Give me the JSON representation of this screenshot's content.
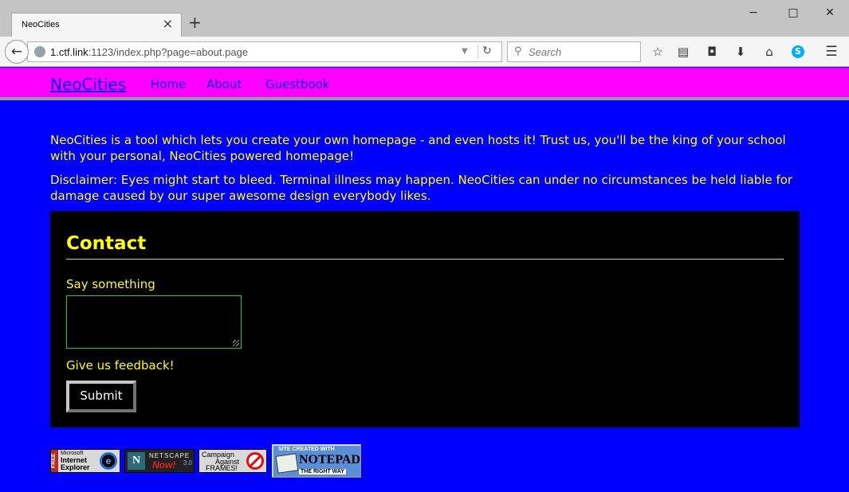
{
  "browser": {
    "tab_title": "NeoCities",
    "tab_close": "×",
    "new_tab": "+",
    "window_controls": {
      "minimize": "−",
      "maximize": "□",
      "close": "✕"
    },
    "url": {
      "host": "1.ctf.link",
      "rest": ":1123/index.php?page=about.page"
    },
    "search_placeholder": "Search",
    "toolbar_icons": [
      "star-icon",
      "reader-list-icon",
      "pocket-icon",
      "download-icon",
      "home-icon",
      "skype-icon",
      "menu-icon"
    ]
  },
  "site": {
    "brand": "NeoCities",
    "nav": [
      {
        "label": "Home"
      },
      {
        "label": "About"
      },
      {
        "label": "Guestbook"
      }
    ],
    "paragraphs": [
      "NeoCities is a tool which lets you create your own homepage - and even hosts it! Trust us, you'll be the king of your school with your personal, NeoCities powered homepage!",
      "Disclaimer: Eyes might start to bleed. Terminal illness may happen. NeoCities can under no circumstances be held liable for damage caused by our super awesome design everybody likes."
    ],
    "contact": {
      "title": "Contact",
      "textarea_label": "Say something",
      "textarea_value": "",
      "feedback_label": "Give us feedback!",
      "submit_label": "Submit"
    },
    "badges": {
      "ie": {
        "free": "FREE",
        "line1": "Microsoft",
        "line2": "Internet",
        "line3": "Explorer",
        "logo": "e"
      },
      "netscape": {
        "logo": "N",
        "line1": "NETSCAPE",
        "line2": "Now!",
        "line3": "3.0"
      },
      "frames": {
        "line1": "Campaign",
        "line2": "Against",
        "line3": "FRAMES!"
      },
      "notepad": {
        "line1": "SITE CREATED WITH",
        "line2": "NOTEPAD",
        "line3": "THE RIGHT WAY"
      }
    }
  },
  "colors": {
    "page_bg": "#0000ff",
    "header_bg": "#ff00ff",
    "text_yellow": "#ffff00",
    "link_blue": "#0000ff",
    "box_bg": "#000000",
    "textarea_border": "#22cc22"
  }
}
